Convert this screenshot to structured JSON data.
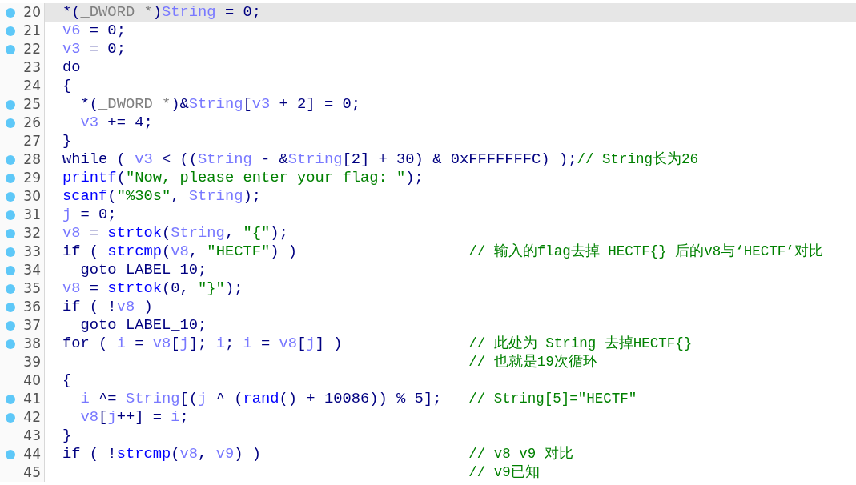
{
  "lines": [
    {
      "number": "20",
      "marked": true,
      "selected": true,
      "code": [
        {
          "kind": "plain",
          "text": "*("
        },
        {
          "kind": "cast",
          "text": "_DWORD *"
        },
        {
          "kind": "plain",
          "text": ")"
        },
        {
          "kind": "var",
          "text": "String"
        },
        {
          "kind": "plain",
          "text": " = 0;"
        }
      ]
    },
    {
      "number": "21",
      "marked": true,
      "selected": false,
      "code": [
        {
          "kind": "var",
          "text": "v6"
        },
        {
          "kind": "plain",
          "text": " = 0;"
        }
      ]
    },
    {
      "number": "22",
      "marked": true,
      "selected": false,
      "code": [
        {
          "kind": "var",
          "text": "v3"
        },
        {
          "kind": "plain",
          "text": " = 0;"
        }
      ]
    },
    {
      "number": "23",
      "marked": false,
      "selected": false,
      "code": [
        {
          "kind": "plain",
          "text": "do"
        }
      ]
    },
    {
      "number": "24",
      "marked": false,
      "selected": false,
      "code": [
        {
          "kind": "plain",
          "text": "{"
        }
      ]
    },
    {
      "number": "25",
      "marked": true,
      "selected": false,
      "code": [
        {
          "kind": "plain",
          "text": "  *("
        },
        {
          "kind": "cast",
          "text": "_DWORD *"
        },
        {
          "kind": "plain",
          "text": ")&"
        },
        {
          "kind": "var",
          "text": "String"
        },
        {
          "kind": "plain",
          "text": "["
        },
        {
          "kind": "var",
          "text": "v3"
        },
        {
          "kind": "plain",
          "text": " + 2] = 0;"
        }
      ]
    },
    {
      "number": "26",
      "marked": true,
      "selected": false,
      "code": [
        {
          "kind": "var",
          "text": "  v3"
        },
        {
          "kind": "plain",
          "text": " += 4;"
        }
      ]
    },
    {
      "number": "27",
      "marked": false,
      "selected": false,
      "code": [
        {
          "kind": "plain",
          "text": "}"
        }
      ]
    },
    {
      "number": "28",
      "marked": true,
      "selected": false,
      "code": [
        {
          "kind": "plain",
          "text": "while ( "
        },
        {
          "kind": "var",
          "text": "v3"
        },
        {
          "kind": "plain",
          "text": " < (("
        },
        {
          "kind": "var",
          "text": "String"
        },
        {
          "kind": "plain",
          "text": " - &"
        },
        {
          "kind": "var",
          "text": "String"
        },
        {
          "kind": "plain",
          "text": "[2] + 30) & 0xFFFFFFFC) );"
        }
      ],
      "comment": "// String长为26"
    },
    {
      "number": "29",
      "marked": true,
      "selected": false,
      "code": [
        {
          "kind": "func",
          "text": "printf"
        },
        {
          "kind": "plain",
          "text": "("
        },
        {
          "kind": "str",
          "text": "\"Now, please enter your flag: \""
        },
        {
          "kind": "plain",
          "text": ");"
        }
      ]
    },
    {
      "number": "30",
      "marked": true,
      "selected": false,
      "code": [
        {
          "kind": "func",
          "text": "scanf"
        },
        {
          "kind": "plain",
          "text": "("
        },
        {
          "kind": "str",
          "text": "\"%30s\""
        },
        {
          "kind": "plain",
          "text": ", "
        },
        {
          "kind": "var",
          "text": "String"
        },
        {
          "kind": "plain",
          "text": ");"
        }
      ]
    },
    {
      "number": "31",
      "marked": true,
      "selected": false,
      "code": [
        {
          "kind": "var",
          "text": "j"
        },
        {
          "kind": "plain",
          "text": " = 0;"
        }
      ]
    },
    {
      "number": "32",
      "marked": true,
      "selected": false,
      "code": [
        {
          "kind": "var",
          "text": "v8"
        },
        {
          "kind": "plain",
          "text": " = "
        },
        {
          "kind": "func",
          "text": "strtok"
        },
        {
          "kind": "plain",
          "text": "("
        },
        {
          "kind": "var",
          "text": "String"
        },
        {
          "kind": "plain",
          "text": ", "
        },
        {
          "kind": "str",
          "text": "\"{\""
        },
        {
          "kind": "plain",
          "text": ");"
        }
      ]
    },
    {
      "number": "33",
      "marked": true,
      "selected": false,
      "code": [
        {
          "kind": "plain",
          "text": "if ( "
        },
        {
          "kind": "func",
          "text": "strcmp"
        },
        {
          "kind": "plain",
          "text": "("
        },
        {
          "kind": "var",
          "text": "v8"
        },
        {
          "kind": "plain",
          "text": ", "
        },
        {
          "kind": "str",
          "text": "\"HECTF\""
        },
        {
          "kind": "plain",
          "text": ") )"
        }
      ],
      "comment": "// 输入的flag去掉 HECTF{} 后的v8与‘HECTF’对比"
    },
    {
      "number": "34",
      "marked": true,
      "selected": false,
      "code": [
        {
          "kind": "plain",
          "text": "  goto LABEL_10;"
        }
      ]
    },
    {
      "number": "35",
      "marked": true,
      "selected": false,
      "code": [
        {
          "kind": "var",
          "text": "v8"
        },
        {
          "kind": "plain",
          "text": " = "
        },
        {
          "kind": "func",
          "text": "strtok"
        },
        {
          "kind": "plain",
          "text": "(0, "
        },
        {
          "kind": "str",
          "text": "\"}\""
        },
        {
          "kind": "plain",
          "text": ");"
        }
      ]
    },
    {
      "number": "36",
      "marked": true,
      "selected": false,
      "code": [
        {
          "kind": "plain",
          "text": "if ( !"
        },
        {
          "kind": "var",
          "text": "v8"
        },
        {
          "kind": "plain",
          "text": " )"
        }
      ]
    },
    {
      "number": "37",
      "marked": true,
      "selected": false,
      "code": [
        {
          "kind": "plain",
          "text": "  goto LABEL_10;"
        }
      ]
    },
    {
      "number": "38",
      "marked": true,
      "selected": false,
      "code": [
        {
          "kind": "plain",
          "text": "for ( "
        },
        {
          "kind": "var",
          "text": "i"
        },
        {
          "kind": "plain",
          "text": " = "
        },
        {
          "kind": "var",
          "text": "v8"
        },
        {
          "kind": "plain",
          "text": "["
        },
        {
          "kind": "var",
          "text": "j"
        },
        {
          "kind": "plain",
          "text": "]; "
        },
        {
          "kind": "var",
          "text": "i"
        },
        {
          "kind": "plain",
          "text": "; "
        },
        {
          "kind": "var",
          "text": "i"
        },
        {
          "kind": "plain",
          "text": " = "
        },
        {
          "kind": "var",
          "text": "v8"
        },
        {
          "kind": "plain",
          "text": "["
        },
        {
          "kind": "var",
          "text": "j"
        },
        {
          "kind": "plain",
          "text": "] )"
        }
      ],
      "comment": "// 此处为 String 去掉HECTF{}"
    },
    {
      "number": "39",
      "marked": false,
      "selected": false,
      "comment": "// 也就是19次循环"
    },
    {
      "number": "40",
      "marked": false,
      "selected": false,
      "code": [
        {
          "kind": "plain",
          "text": "{"
        }
      ]
    },
    {
      "number": "41",
      "marked": true,
      "selected": false,
      "code": [
        {
          "kind": "var",
          "text": "  i"
        },
        {
          "kind": "plain",
          "text": " ^= "
        },
        {
          "kind": "var",
          "text": "String"
        },
        {
          "kind": "plain",
          "text": "[("
        },
        {
          "kind": "var",
          "text": "j"
        },
        {
          "kind": "plain",
          "text": " ^ ("
        },
        {
          "kind": "func",
          "text": "rand"
        },
        {
          "kind": "plain",
          "text": "() + 10086)) % 5];"
        }
      ],
      "comment": "// String[5]=\"HECTF\""
    },
    {
      "number": "42",
      "marked": true,
      "selected": false,
      "code": [
        {
          "kind": "var",
          "text": "  v8"
        },
        {
          "kind": "plain",
          "text": "["
        },
        {
          "kind": "var",
          "text": "j"
        },
        {
          "kind": "plain",
          "text": "++] = "
        },
        {
          "kind": "var",
          "text": "i"
        },
        {
          "kind": "plain",
          "text": ";"
        }
      ]
    },
    {
      "number": "43",
      "marked": false,
      "selected": false,
      "code": [
        {
          "kind": "plain",
          "text": "}"
        }
      ]
    },
    {
      "number": "44",
      "marked": true,
      "selected": false,
      "code": [
        {
          "kind": "plain",
          "text": "if ( !"
        },
        {
          "kind": "func",
          "text": "strcmp"
        },
        {
          "kind": "plain",
          "text": "("
        },
        {
          "kind": "var",
          "text": "v8"
        },
        {
          "kind": "plain",
          "text": ", "
        },
        {
          "kind": "var",
          "text": "v9"
        },
        {
          "kind": "plain",
          "text": ") )"
        }
      ],
      "comment": "// v8 v9 对比"
    },
    {
      "number": "45",
      "marked": false,
      "selected": false,
      "comment": "// v9已知"
    }
  ]
}
